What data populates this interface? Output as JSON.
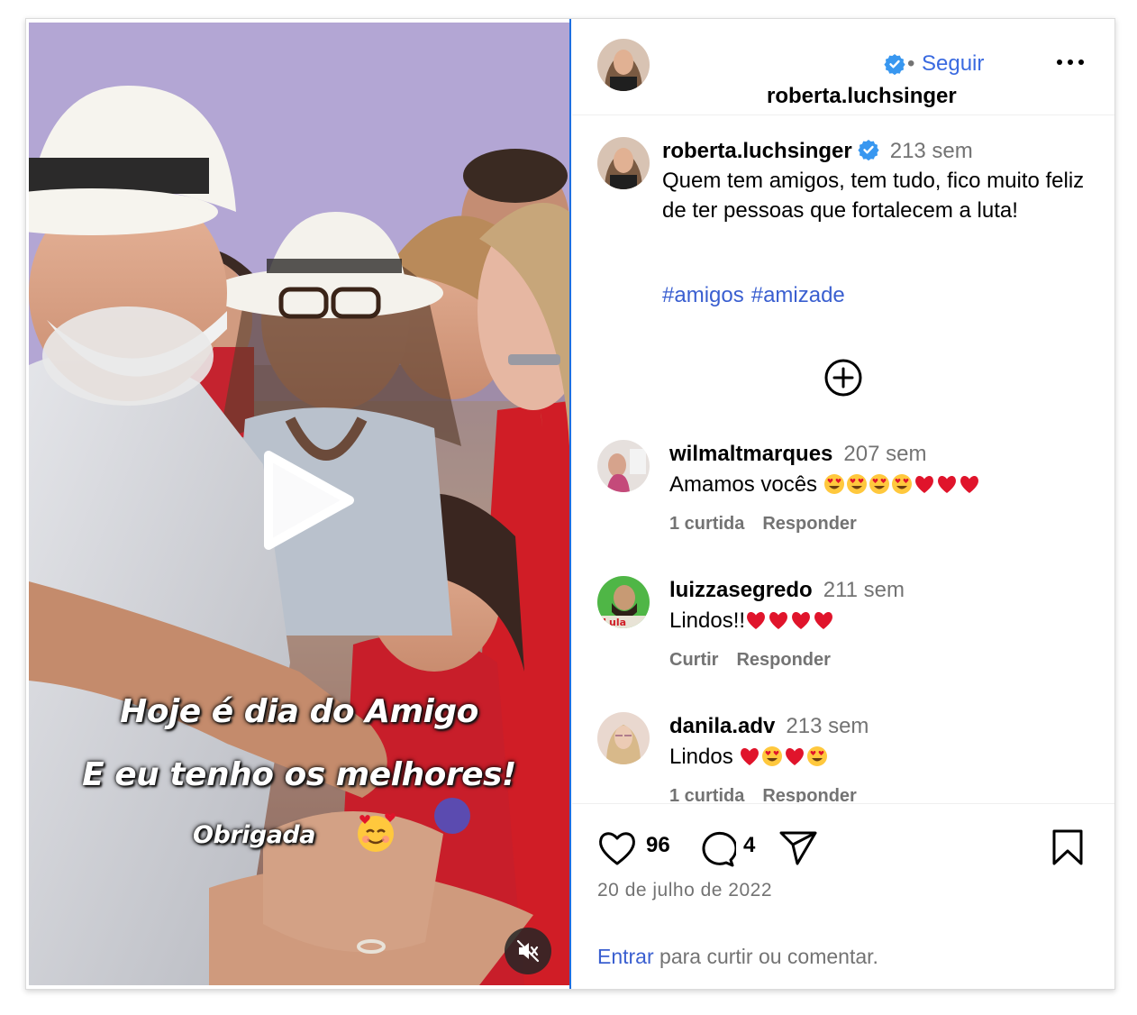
{
  "media": {
    "caption_lines": [
      "Hoje é dia do Amigo",
      "E eu tenho os melhores!",
      "Obrigada"
    ],
    "caption_emoji": "smiling-face-with-hearts",
    "play_icon": "play-icon",
    "mute_icon": "speaker-muted-icon"
  },
  "header": {
    "username": "roberta.luchsinger",
    "separator": "•",
    "follow_label": "Seguir",
    "more_icon": "more-options-icon"
  },
  "post": {
    "username": "roberta.luchsinger",
    "time": "213 sem",
    "text": "Quem tem amigos, tem tudo, fico muito feliz de ter pessoas que fortalecem a luta!",
    "hashtags": [
      "#amigos",
      "#amizade"
    ],
    "load_more_icon": "plus-circle-icon"
  },
  "comments": [
    {
      "username": "wilmaltmarques",
      "time": "207 sem",
      "text": "Amamos vocês",
      "emojis": [
        "heart-eyes",
        "heart-eyes",
        "heart-eyes",
        "heart-eyes",
        "red-heart",
        "red-heart",
        "red-heart"
      ],
      "like_label": "1 curtida",
      "reply_label": "Responder"
    },
    {
      "username": "luizzasegredo",
      "time": "211 sem",
      "text": "Lindos!!",
      "emojis": [
        "red-heart",
        "red-heart",
        "red-heart",
        "red-heart"
      ],
      "like_label": "Curtir",
      "reply_label": "Responder"
    },
    {
      "username": "danila.adv",
      "time": "213 sem",
      "text": "Lindos",
      "emojis": [
        "red-heart",
        "heart-eyes",
        "red-heart",
        "heart-eyes"
      ],
      "like_label": "1 curtida",
      "reply_label": "Responder"
    }
  ],
  "footer": {
    "likes_count": "96",
    "comments_count": "4",
    "date": "20 de julho de 2022",
    "login_link": "Entrar",
    "login_text": " para curtir ou comentar."
  },
  "colors": {
    "link": "#3a5fd0",
    "follow": "#3a6ae0",
    "verified": "#3897f0",
    "muted_text": "#737373",
    "heart": "#e0142b"
  }
}
